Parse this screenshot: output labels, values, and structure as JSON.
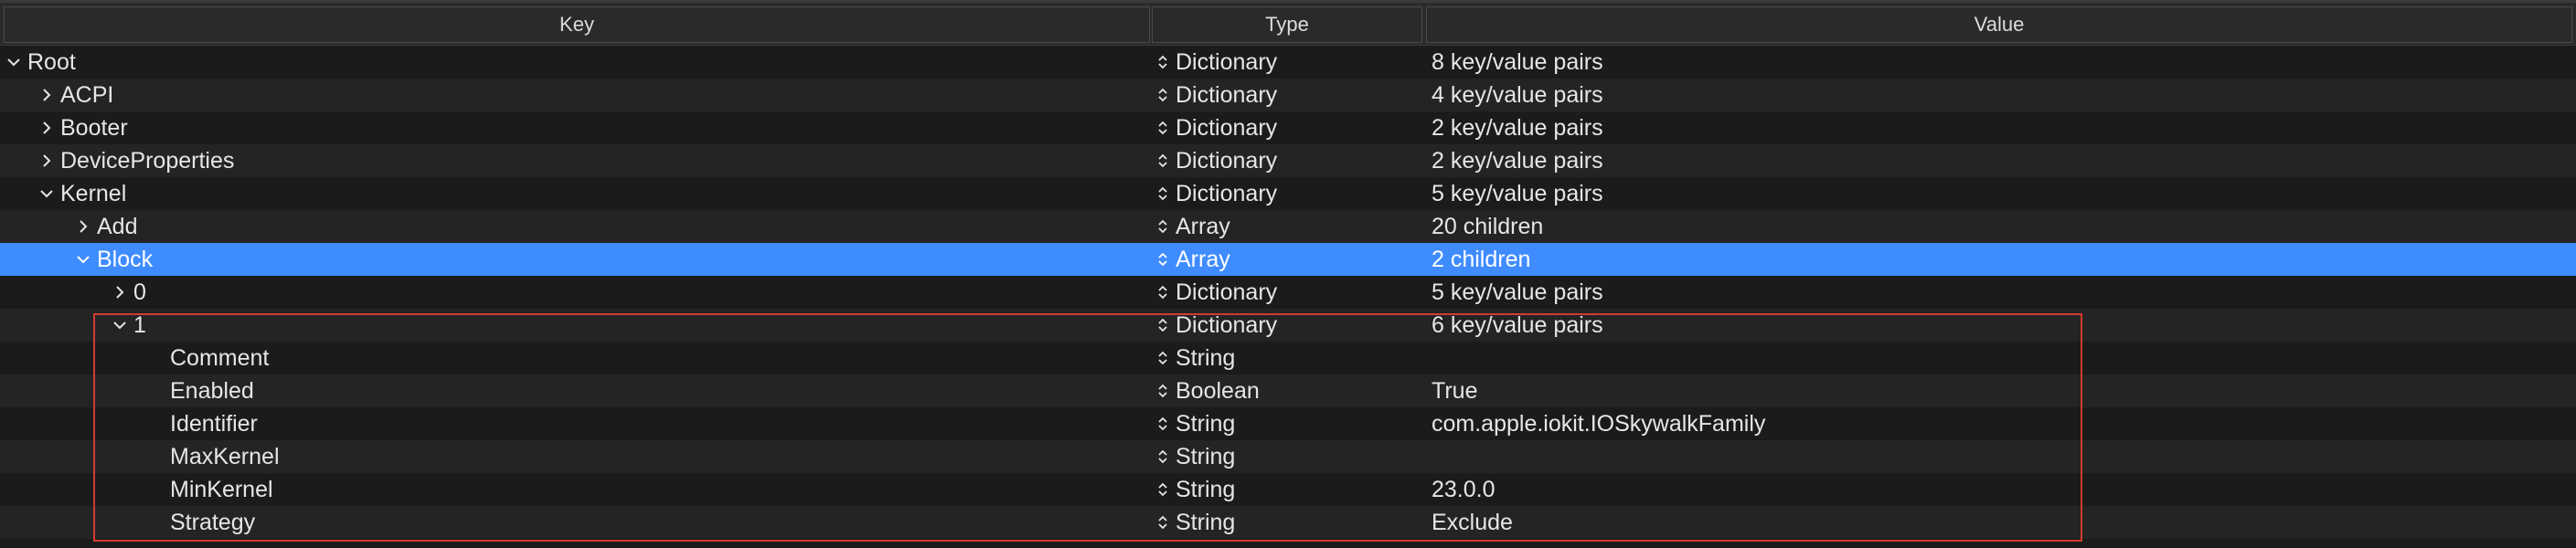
{
  "columns": {
    "key": "Key",
    "type": "Type",
    "value": "Value"
  },
  "rows": [
    {
      "key": "Root",
      "type": "Dictionary",
      "value": "8 key/value pairs",
      "expanded": true
    },
    {
      "key": "ACPI",
      "type": "Dictionary",
      "value": "4 key/value pairs",
      "expanded": false
    },
    {
      "key": "Booter",
      "type": "Dictionary",
      "value": "2 key/value pairs",
      "expanded": false
    },
    {
      "key": "DeviceProperties",
      "type": "Dictionary",
      "value": "2 key/value pairs",
      "expanded": false
    },
    {
      "key": "Kernel",
      "type": "Dictionary",
      "value": "5 key/value pairs",
      "expanded": true
    },
    {
      "key": "Add",
      "type": "Array",
      "value": "20 children",
      "expanded": false
    },
    {
      "key": "Block",
      "type": "Array",
      "value": "2 children",
      "expanded": true,
      "selected": true
    },
    {
      "key": "0",
      "type": "Dictionary",
      "value": "5 key/value pairs",
      "expanded": false
    },
    {
      "key": "1",
      "type": "Dictionary",
      "value": "6 key/value pairs",
      "expanded": true
    },
    {
      "key": "Comment",
      "type": "String",
      "value": ""
    },
    {
      "key": "Enabled",
      "type": "Boolean",
      "value": "True"
    },
    {
      "key": "Identifier",
      "type": "String",
      "value": "com.apple.iokit.IOSkywalkFamily"
    },
    {
      "key": "MaxKernel",
      "type": "String",
      "value": ""
    },
    {
      "key": "MinKernel",
      "type": "String",
      "value": "23.0.0"
    },
    {
      "key": "Strategy",
      "type": "String",
      "value": "Exclude"
    }
  ],
  "colors": {
    "selection": "#3f8cff",
    "highlight_border": "#d33b2f"
  }
}
